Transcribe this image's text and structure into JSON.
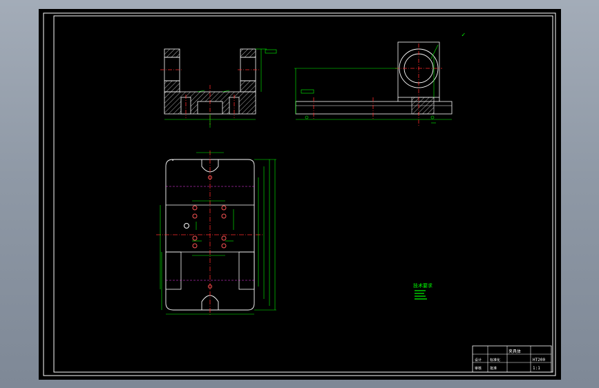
{
  "colors": {
    "background": "#000000",
    "frame": "#ffffff",
    "geometry": "#ffffff",
    "dimension": "#00ff00",
    "centerline": "#ff2a2a",
    "hidden": "#ff3cff",
    "hatch": "#ffffff",
    "viewport_bg": "#8f99a6"
  },
  "notes": {
    "roughness_symbol": "✓",
    "technical_requirements": "技术要求"
  },
  "title_block": {
    "part_name": "夹具体",
    "scale": "1:1",
    "material": "HT200",
    "cell_1": "设计",
    "cell_2": "审核",
    "cell_3": "标准化",
    "cell_4": "批准"
  }
}
